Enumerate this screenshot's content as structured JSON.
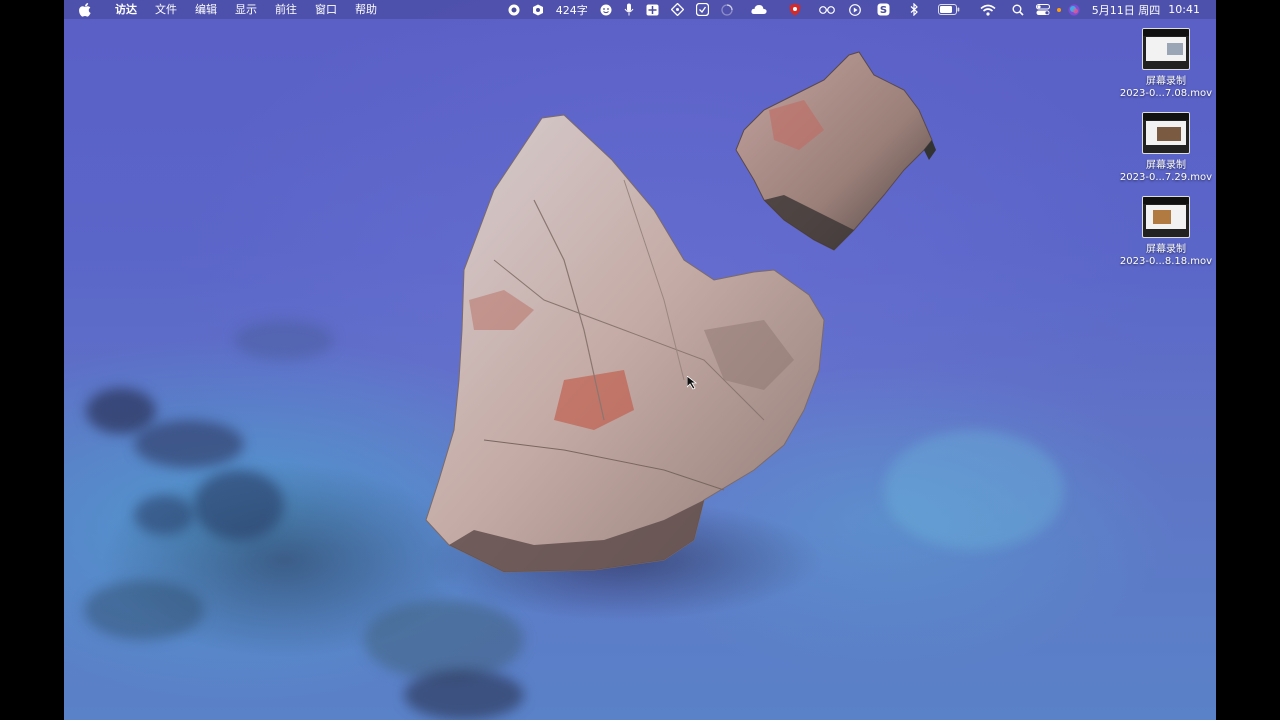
{
  "menubar": {
    "app_name": "访达",
    "items": [
      "文件",
      "编辑",
      "显示",
      "前往",
      "窗口",
      "帮助"
    ],
    "word_count": "424字",
    "date": "5月11日 周四",
    "time": "10:41"
  },
  "desktop_icons": [
    {
      "line1": "屏幕录制",
      "line2": "2023-0...7.08.mov"
    },
    {
      "line1": "屏幕录制",
      "line2": "2023-0...7.29.mov"
    },
    {
      "line1": "屏幕录制",
      "line2": "2023-0...8.18.mov"
    }
  ],
  "colors": {
    "water": "#5a66c8",
    "teal": "#4fb7d4",
    "rock": "#c9b6ad",
    "menubar": "#46469a"
  }
}
